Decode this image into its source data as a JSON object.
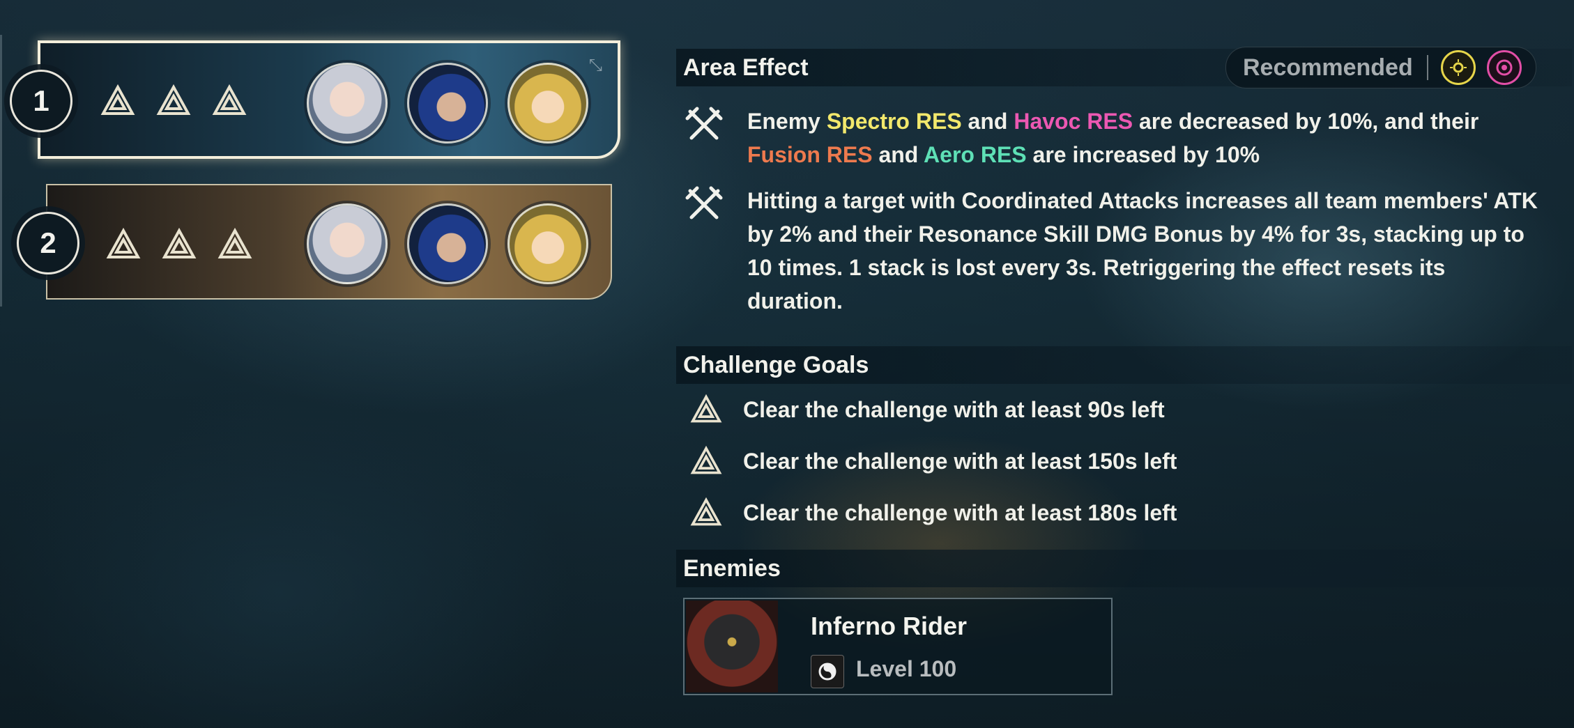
{
  "teams": [
    {
      "number": "1",
      "selected": true,
      "goal_icons": [
        "triangle-icon",
        "triangle-icon",
        "triangle-icon"
      ],
      "avatars": [
        "character-avatar",
        "character-avatar",
        "character-avatar"
      ]
    },
    {
      "number": "2",
      "selected": false,
      "goal_icons": [
        "triangle-icon",
        "triangle-icon",
        "triangle-icon"
      ],
      "avatars": [
        "character-avatar",
        "character-avatar",
        "character-avatar"
      ]
    }
  ],
  "area_effect": {
    "title": "Area Effect",
    "recommended_label": "Recommended",
    "recommended_elements": [
      "spectro-icon",
      "havoc-icon"
    ],
    "effects": [
      {
        "parts": [
          "Enemy ",
          "Spectro RES",
          " and ",
          "Havoc RES",
          " are decreased by 10%, and their ",
          "Fusion RES",
          " and ",
          "Aero RES",
          " are increased by 10%"
        ]
      },
      {
        "text": "Hitting a target with Coordinated Attacks increases all team members' ATK by 2% and their Resonance Skill DMG Bonus by 4% for 3s, stacking up to 10 times. 1 stack is lost every 3s. Retriggering the effect resets its duration."
      }
    ]
  },
  "challenge_goals": {
    "title": "Challenge Goals",
    "items": [
      "Clear the challenge with at least 90s left",
      "Clear the challenge with at least 150s left",
      "Clear the challenge with at least 180s left"
    ]
  },
  "enemies": {
    "title": "Enemies",
    "list": [
      {
        "name": "Inferno Rider",
        "level": "Level 100",
        "element_icon": "havoc-element-icon"
      }
    ]
  },
  "colors": {
    "spectro": "#f2e86c",
    "havoc": "#ec58b2",
    "fusion": "#ee7a4e",
    "aero": "#5ee0b6"
  }
}
